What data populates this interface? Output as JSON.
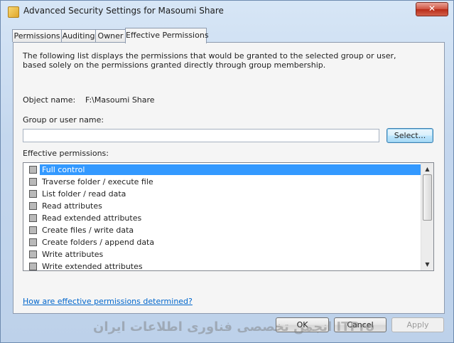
{
  "window": {
    "title": "Advanced Security Settings for Masoumi Share",
    "close_symbol": "✕"
  },
  "tabs": [
    {
      "label": "Permissions"
    },
    {
      "label": "Auditing"
    },
    {
      "label": "Owner"
    },
    {
      "label": "Effective Permissions",
      "active": true
    }
  ],
  "panel": {
    "description": "The following list displays the permissions that would be granted to the selected group or user, based solely on the permissions granted directly through group membership.",
    "object_name_label": "Object name:",
    "object_name_value": "F:\\Masoumi Share",
    "group_label": "Group or user name:",
    "group_value": "",
    "select_button": "Select...",
    "effective_label": "Effective permissions:",
    "permissions": [
      {
        "label": "Full control",
        "checked": false,
        "selected": true
      },
      {
        "label": "Traverse folder / execute file",
        "checked": false
      },
      {
        "label": "List folder / read data",
        "checked": false
      },
      {
        "label": "Read attributes",
        "checked": false
      },
      {
        "label": "Read extended attributes",
        "checked": false
      },
      {
        "label": "Create files / write data",
        "checked": false
      },
      {
        "label": "Create folders / append data",
        "checked": false
      },
      {
        "label": "Write attributes",
        "checked": false
      },
      {
        "label": "Write extended attributes",
        "checked": false
      }
    ],
    "help_link": "How are effective permissions determined?"
  },
  "buttons": {
    "ok": "OK",
    "cancel": "Cancel",
    "apply": "Apply"
  },
  "watermark": "انجمن تخصصی فناوری اطلاعات ایران ITPro"
}
